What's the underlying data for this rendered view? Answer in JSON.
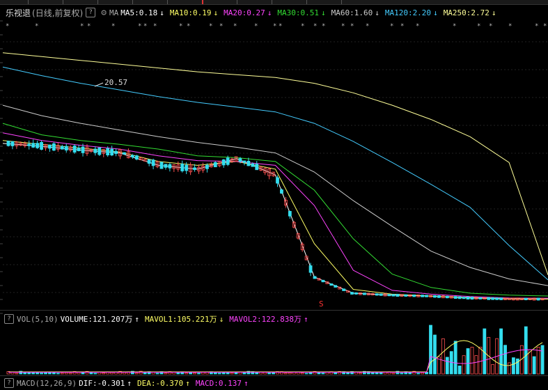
{
  "header": {
    "stock_name": "乐视退",
    "period": "(日线,前复权)",
    "help_icon": "?",
    "settings_icon": "gear-icon",
    "ma_label": "MA",
    "ma_items": [
      {
        "text": "MA5:0.18",
        "arrow": "↓",
        "color": "#ffffff"
      },
      {
        "text": "MA10:0.19",
        "arrow": "↓",
        "color": "#ffff66"
      },
      {
        "text": "MA20:0.27",
        "arrow": "↓",
        "color": "#ff44ff"
      },
      {
        "text": "MA30:0.51",
        "arrow": "↓",
        "color": "#33dd33"
      },
      {
        "text": "MA60:1.60",
        "arrow": "↓",
        "color": "#cccccc"
      },
      {
        "text": "MA120:2.20",
        "arrow": "↓",
        "color": "#44ccff"
      },
      {
        "text": "MA250:2.72",
        "arrow": "↓",
        "color": "#ffff99"
      }
    ]
  },
  "price_chart": {
    "high_label": "20.57",
    "marker": "S"
  },
  "volume_header": {
    "label": "VOL(5,10)",
    "items": [
      {
        "text": "VOLUME:121.207万",
        "arrow": "↑",
        "color": "#ffffff"
      },
      {
        "text": "MAVOL1:105.221万",
        "arrow": "↓",
        "color": "#ffff66"
      },
      {
        "text": "MAVOL2:122.838万",
        "arrow": "↑",
        "color": "#ff44ff"
      }
    ]
  },
  "macd_header": {
    "label": "MACD(12,26,9)",
    "items": [
      {
        "text": "DIF:-0.301",
        "arrow": "↑",
        "color": "#ffffff"
      },
      {
        "text": "DEA:-0.370",
        "arrow": "↑",
        "color": "#ffff66"
      },
      {
        "text": "MACD:0.137",
        "arrow": "↑",
        "color": "#ff44ff"
      }
    ]
  },
  "chart_data": {
    "type": "line",
    "series": [
      {
        "name": "MA5",
        "values": [
          16.5,
          16.2,
          15.8,
          15.5,
          14.2,
          13.8,
          14.9,
          13.2,
          2.5,
          0.8,
          0.6,
          0.5,
          0.3,
          0.2,
          0.18
        ]
      },
      {
        "name": "MA10",
        "values": [
          16.8,
          16.4,
          16.0,
          15.6,
          14.6,
          14.2,
          14.6,
          13.8,
          6.0,
          1.2,
          0.7,
          0.5,
          0.35,
          0.22,
          0.19
        ]
      },
      {
        "name": "MA20",
        "values": [
          17.6,
          16.8,
          16.3,
          15.9,
          15.2,
          14.7,
          14.6,
          14.2,
          10.0,
          3.2,
          1.1,
          0.7,
          0.45,
          0.3,
          0.27
        ]
      },
      {
        "name": "MA30",
        "values": [
          18.6,
          17.4,
          16.8,
          16.4,
          15.9,
          15.2,
          15.0,
          14.6,
          11.6,
          6.5,
          2.8,
          1.4,
          0.8,
          0.6,
          0.51
        ]
      },
      {
        "name": "MA60",
        "values": [
          20.5,
          19.4,
          18.6,
          17.9,
          17.2,
          16.6,
          16.1,
          15.5,
          13.5,
          10.5,
          7.8,
          5.2,
          3.5,
          2.3,
          1.6
        ]
      },
      {
        "name": "MA120",
        "values": [
          24.5,
          23.6,
          22.8,
          22.1,
          21.4,
          20.8,
          20.3,
          19.8,
          18.6,
          16.7,
          14.5,
          12.2,
          9.8,
          5.8,
          2.2
        ]
      },
      {
        "name": "MA250",
        "values": [
          26.0,
          25.6,
          25.2,
          24.8,
          24.4,
          24.0,
          23.7,
          23.4,
          22.8,
          21.8,
          20.5,
          19.0,
          17.2,
          14.5,
          2.72
        ]
      }
    ]
  }
}
